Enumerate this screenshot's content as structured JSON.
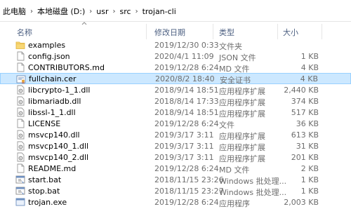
{
  "breadcrumb": [
    "此电脑",
    "本地磁盘 (D:)",
    "usr",
    "src",
    "trojan-cli"
  ],
  "columns": {
    "name": "名称",
    "date": "修改日期",
    "type": "类型",
    "size": "大小"
  },
  "files": [
    {
      "icon": "folder-icon",
      "name": "examples",
      "date": "2019/12/30 0:33",
      "type": "文件夹",
      "size": ""
    },
    {
      "icon": "file-icon",
      "name": "config.json",
      "date": "2020/4/1 11:09",
      "type": "JSON 文件",
      "size": "1 KB"
    },
    {
      "icon": "file-icon",
      "name": "CONTRIBUTORS.md",
      "date": "2019/12/28 6:24",
      "type": "MD 文件",
      "size": "4 KB"
    },
    {
      "icon": "certificate-icon",
      "name": "fullchain.cer",
      "date": "2020/8/2 18:40",
      "type": "安全证书",
      "size": "4 KB",
      "selected": true
    },
    {
      "icon": "dll-icon",
      "name": "libcrypto-1_1.dll",
      "date": "2018/9/14 18:51",
      "type": "应用程序扩展",
      "size": "2,440 KB"
    },
    {
      "icon": "dll-icon",
      "name": "libmariadb.dll",
      "date": "2018/8/14 17:33",
      "type": "应用程序扩展",
      "size": "374 KB"
    },
    {
      "icon": "dll-icon",
      "name": "libssl-1_1.dll",
      "date": "2018/9/14 18:51",
      "type": "应用程序扩展",
      "size": "517 KB"
    },
    {
      "icon": "file-icon",
      "name": "LICENSE",
      "date": "2019/12/28 6:24",
      "type": "文件",
      "size": "36 KB"
    },
    {
      "icon": "dll-icon",
      "name": "msvcp140.dll",
      "date": "2019/3/17 3:11",
      "type": "应用程序扩展",
      "size": "613 KB"
    },
    {
      "icon": "dll-icon",
      "name": "msvcp140_1.dll",
      "date": "2019/3/17 3:11",
      "type": "应用程序扩展",
      "size": "31 KB"
    },
    {
      "icon": "dll-icon",
      "name": "msvcp140_2.dll",
      "date": "2019/3/17 3:11",
      "type": "应用程序扩展",
      "size": "201 KB"
    },
    {
      "icon": "file-icon",
      "name": "README.md",
      "date": "2019/12/28 6:24",
      "type": "MD 文件",
      "size": "2 KB"
    },
    {
      "icon": "bat-icon",
      "name": "start.bat",
      "date": "2018/11/15 23:26",
      "type": "Windows 批处理...",
      "size": "1 KB"
    },
    {
      "icon": "bat-icon",
      "name": "stop.bat",
      "date": "2018/11/15 23:27",
      "type": "Windows 批处理...",
      "size": "1 KB"
    },
    {
      "icon": "exe-icon",
      "name": "trojan.exe",
      "date": "2019/12/28 6:24",
      "type": "应用程序",
      "size": "2,003 KB"
    }
  ]
}
